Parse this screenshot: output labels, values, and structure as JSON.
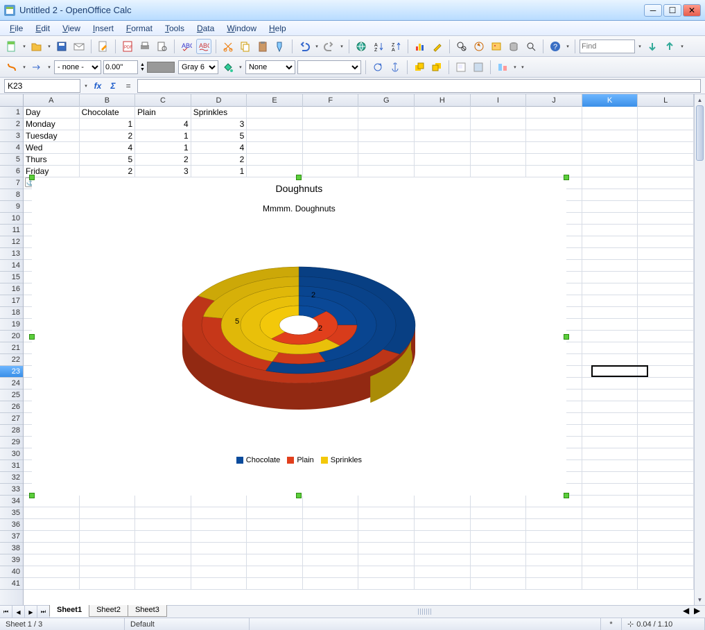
{
  "window": {
    "title": "Untitled 2 - OpenOffice Calc"
  },
  "menus": [
    "File",
    "Edit",
    "View",
    "Insert",
    "Format",
    "Tools",
    "Data",
    "Window",
    "Help"
  ],
  "find": {
    "placeholder": "Find"
  },
  "toolbar2": {
    "line_style": "- none -",
    "line_width": "0.00\"",
    "color_name": "Gray 6",
    "arrow_style": "None"
  },
  "formula": {
    "cellref": "K23",
    "value": ""
  },
  "columns": [
    "A",
    "B",
    "C",
    "D",
    "E",
    "F",
    "G",
    "H",
    "I",
    "J",
    "K",
    "L"
  ],
  "selected_col": "K",
  "row_count": 41,
  "selected_row": 23,
  "cells": {
    "A1": "Day",
    "B1": "Chocolate",
    "C1": "Plain",
    "D1": "Sprinkles",
    "A2": "Monday",
    "B2": "1",
    "C2": "4",
    "D2": "3",
    "A3": "Tuesday",
    "B3": "2",
    "C3": "1",
    "D3": "5",
    "A4": "Wed",
    "B4": "4",
    "C4": "1",
    "D4": "4",
    "A5": "Thurs",
    "B5": "5",
    "C5": "2",
    "D5": "2",
    "A6": "Friday",
    "B6": "2",
    "C6": "3",
    "D6": "1"
  },
  "chart_data": {
    "type": "pie",
    "title": "Doughnuts",
    "subtitle": "Mmmm. Doughnuts",
    "categories": [
      "Monday",
      "Tuesday",
      "Wed",
      "Thurs",
      "Friday"
    ],
    "series": [
      {
        "name": "Chocolate",
        "color": "#0a4b9c",
        "values": [
          1,
          2,
          4,
          5,
          2
        ]
      },
      {
        "name": "Plain",
        "color": "#e13f1c",
        "values": [
          4,
          1,
          1,
          2,
          3
        ]
      },
      {
        "name": "Sprinkles",
        "color": "#f3c80a",
        "values": [
          3,
          5,
          4,
          2,
          1
        ]
      }
    ],
    "data_labels_visible": [
      "5",
      "2",
      "2"
    ]
  },
  "sheets": [
    "Sheet1",
    "Sheet2",
    "Sheet3"
  ],
  "active_sheet": "Sheet1",
  "status": {
    "sheet_pos": "Sheet 1 / 3",
    "style": "Default",
    "modified": "*",
    "coord": "0.04 / 1.10"
  },
  "colors": {
    "chocolate": "#0a4b9c",
    "plain": "#e13f1c",
    "sprinkles": "#f3c80a"
  }
}
